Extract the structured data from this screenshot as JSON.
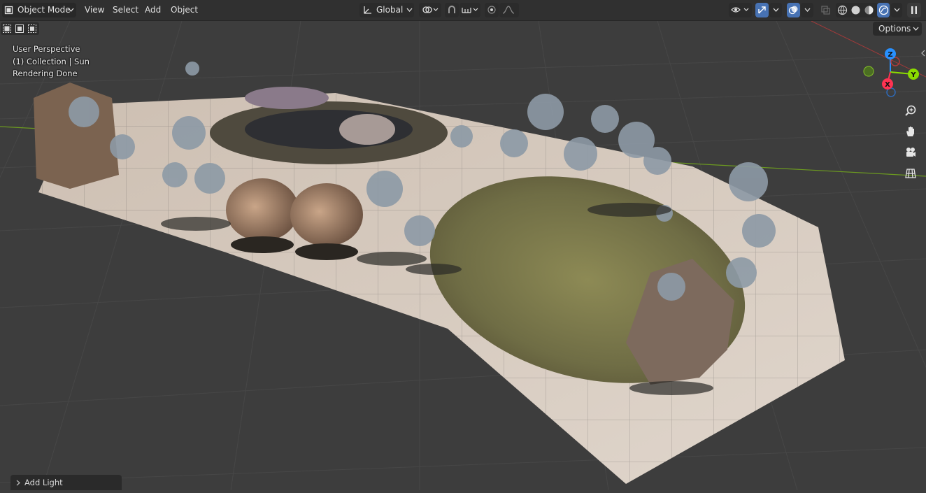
{
  "header": {
    "mode_label": "Object Mode",
    "menu": [
      "View",
      "Select",
      "Add",
      "Object"
    ],
    "transform_orientation": "Global"
  },
  "options_label": "Options",
  "viewport_info": {
    "line1": "User Perspective",
    "line2": "(1) Collection | Sun",
    "line3": "Rendering Done"
  },
  "gizmo": {
    "z": "Z",
    "y": "Y",
    "x": "X"
  },
  "operator_panel": {
    "label": "Add Light"
  },
  "colors": {
    "header_bg": "#303030",
    "viewport_bg": "#3d3d3d",
    "active_button": "#4772b3",
    "axis_x": "#ff3352",
    "axis_y": "#8bdc00",
    "axis_z": "#2890ff"
  }
}
